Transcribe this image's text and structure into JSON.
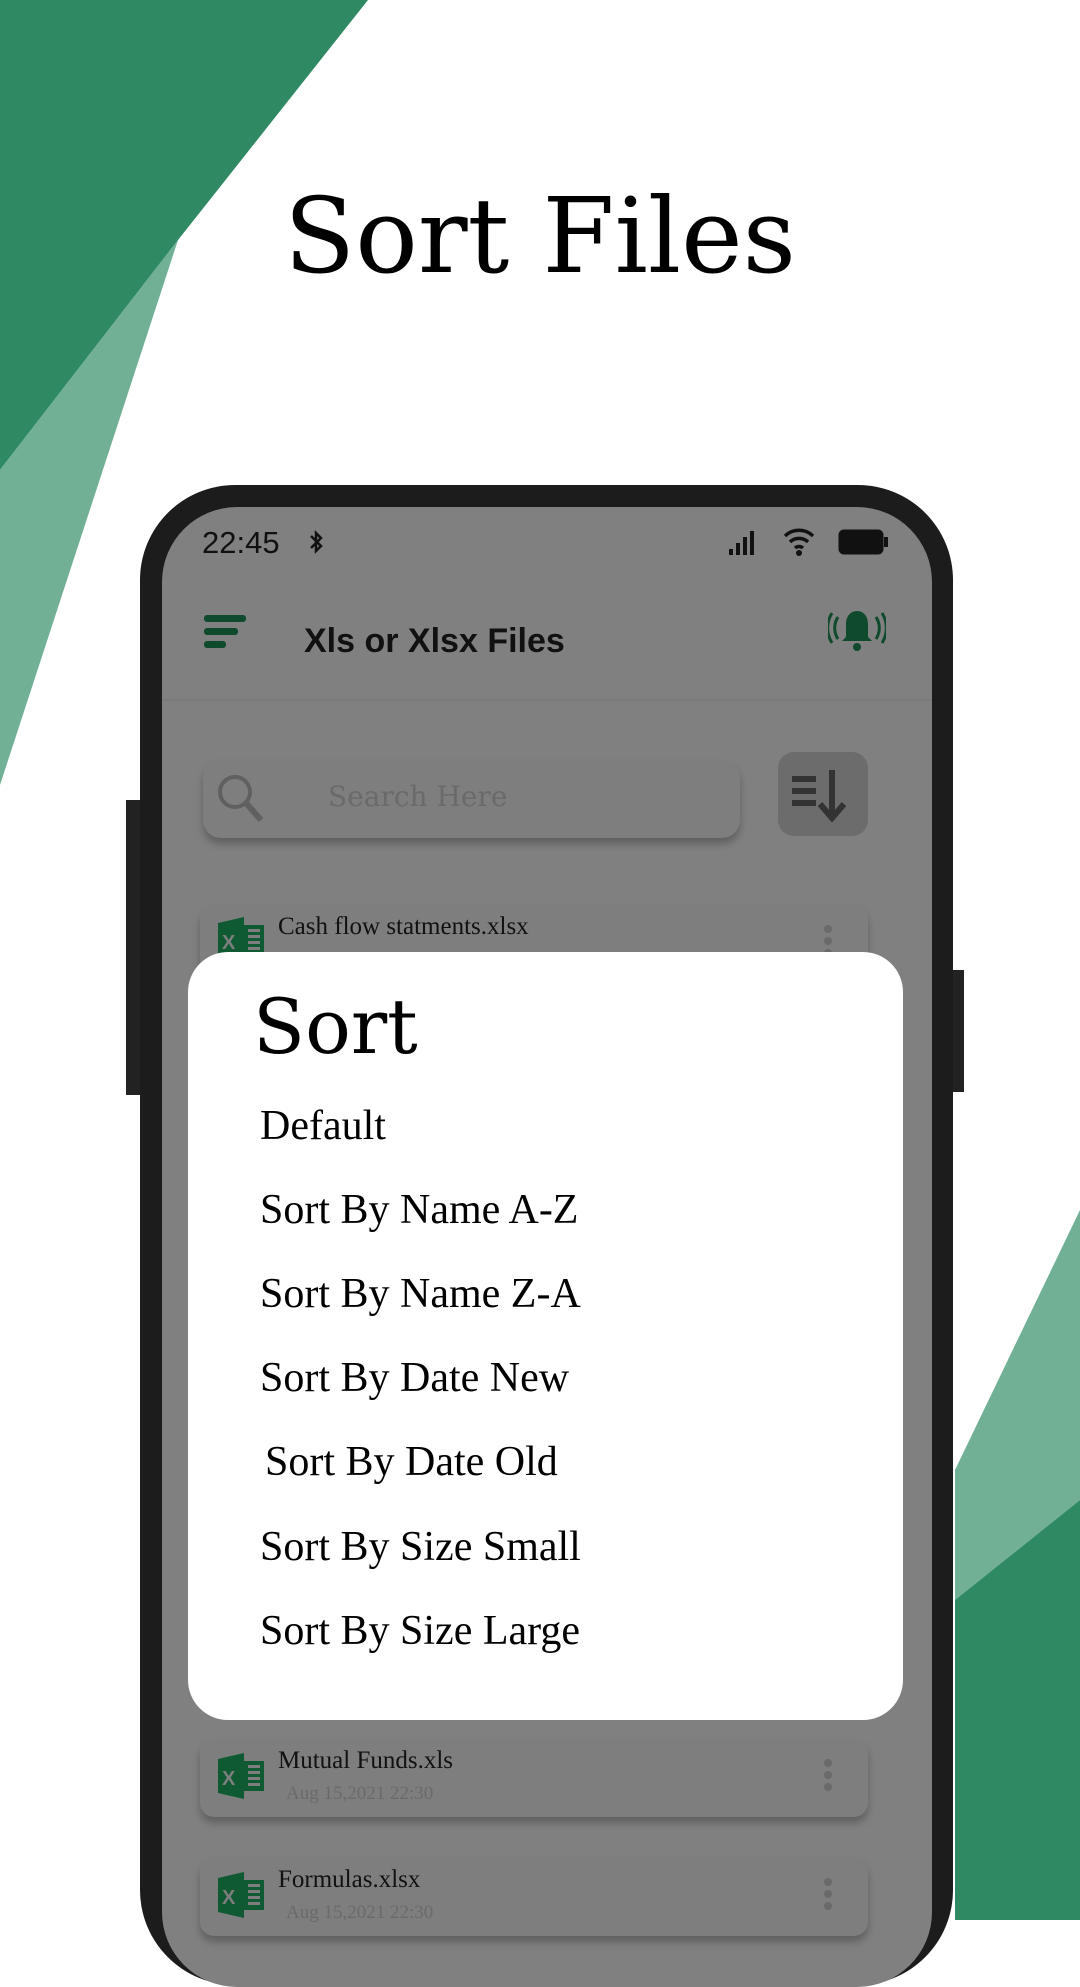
{
  "headline": "Sort Files",
  "colors": {
    "dark_green": "#2f8a63",
    "light_green": "#72b096",
    "icon_green": "#0f4a2c",
    "overlay": "#808080"
  },
  "status_bar": {
    "time": "22:45",
    "icons": [
      "bluetooth-icon",
      "signal-icon",
      "wifi-icon",
      "battery-icon"
    ]
  },
  "app_bar": {
    "title": "Xls or Xlsx Files",
    "menu_icon": "menu-icon",
    "bell_icon": "bell-ringing-icon"
  },
  "search": {
    "placeholder": "Search Here"
  },
  "files": [
    {
      "name": "Cash flow statments.xlsx",
      "date": ""
    },
    {
      "name": "Mutual Funds.xls",
      "date": "Aug 15,2021 22:30"
    },
    {
      "name": "Formulas.xlsx",
      "date": "Aug 15,2021 22:30"
    }
  ],
  "sort_dialog": {
    "title": "Sort",
    "options": [
      "Default",
      "Sort By Name A-Z",
      "Sort By Name Z-A",
      "Sort By Date New",
      "Sort By Date Old",
      "Sort By Size Small",
      "Sort By Size Large"
    ]
  }
}
